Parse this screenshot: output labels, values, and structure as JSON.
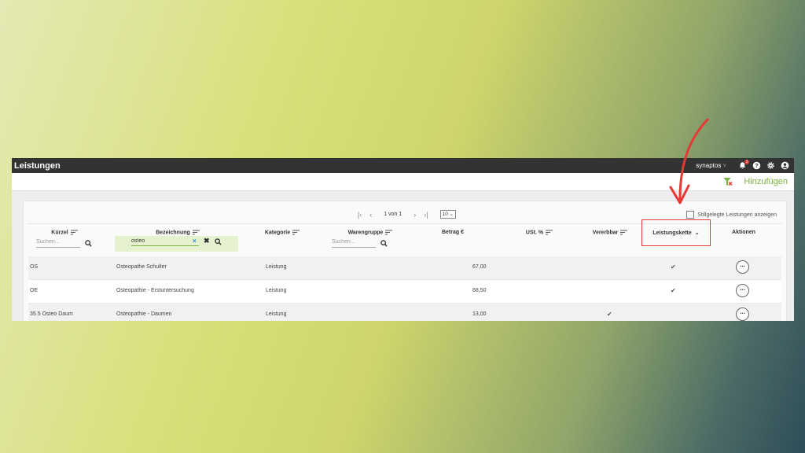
{
  "window": {
    "title": "Leistungen",
    "tenant": "synaptos",
    "notification_count": "1"
  },
  "toolbar": {
    "add_label": "Hinzufügen"
  },
  "pager": {
    "info": "1 von 1",
    "page_size": "10"
  },
  "show_retired": "Stillgelegte Leistungen anzeigen",
  "columns": {
    "kuerzel": "Kürzel",
    "bezeichnung": "Bezeichnung",
    "kategorie": "Kategorie",
    "warengruppe": "Warengruppe",
    "betrag": "Betrag €",
    "ust": "USt. %",
    "vererbbar": "Vererbbar",
    "leistungskette": "Leistungskette",
    "aktionen": "Aktionen"
  },
  "search": {
    "placeholder": "Suchen...",
    "bezeichnung_value": "osteo"
  },
  "rows": [
    {
      "kuerzel": "OS",
      "bezeichnung": "Osteopathe Schulter",
      "kategorie": "Leistung",
      "betrag": "67,00",
      "vererbbar": false,
      "leistungskette": true
    },
    {
      "kuerzel": "OE",
      "bezeichnung": "Osteopathie - Erstuntersuchung",
      "kategorie": "Leistung",
      "betrag": "68,50",
      "vererbbar": false,
      "leistungskette": true
    },
    {
      "kuerzel": "35.5 Osteo Daum",
      "bezeichnung": "Osteopathie - Daumen",
      "kategorie": "Leistung",
      "betrag": "13,00",
      "vererbbar": true,
      "leistungskette": false
    }
  ],
  "colors": {
    "accent_green": "#7cb342",
    "highlight_red": "#e53935",
    "titlebar": "#333333"
  },
  "icons": [
    "bell-icon",
    "help-icon",
    "gear-icon",
    "user-icon",
    "filter-clear-icon",
    "sort-icon",
    "search-icon",
    "check-icon",
    "more-icon"
  ]
}
